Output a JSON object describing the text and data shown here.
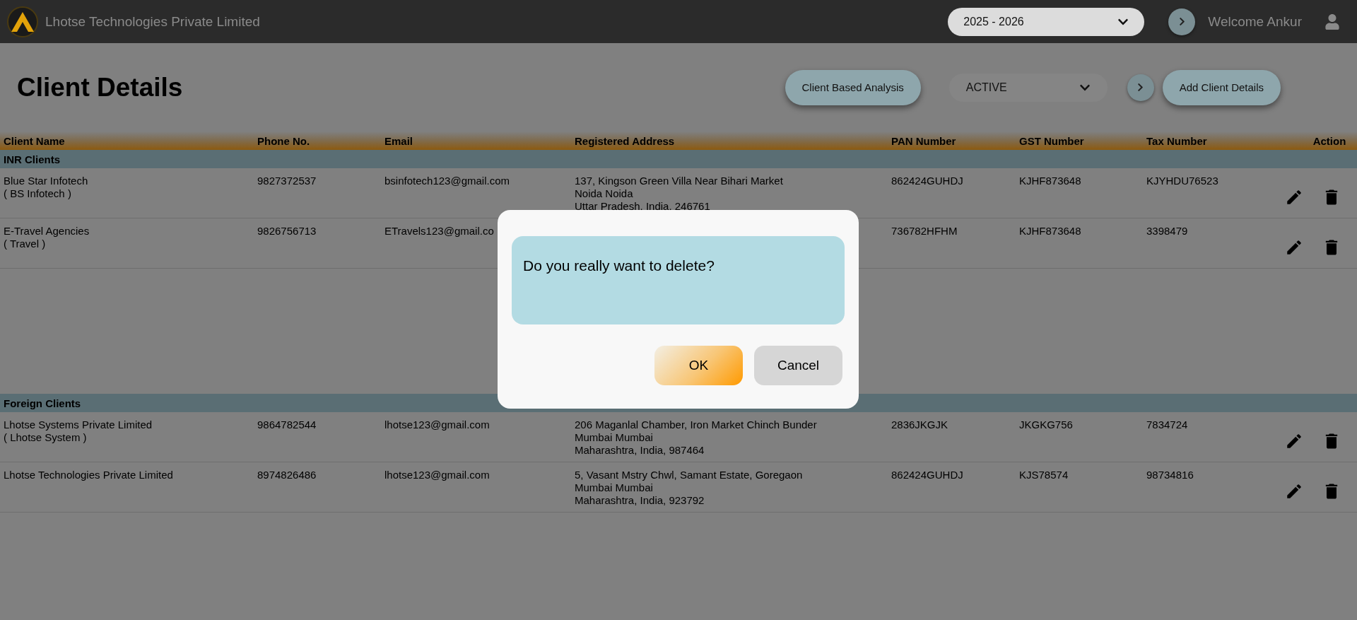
{
  "topbar": {
    "company": "Lhotse Technologies Private Limited",
    "year_select": {
      "value": "2025 - 2026"
    },
    "welcome": "Welcome Ankur"
  },
  "page": {
    "title": "Client Details",
    "analysis_button": "Client Based Analysis",
    "status_select": {
      "value": "ACTIVE"
    },
    "add_button": "Add Client Details"
  },
  "table": {
    "columns": [
      "Client Name",
      "Phone No.",
      "Email",
      "Registered Address",
      "PAN Number",
      "GST Number",
      "Tax Number",
      "Action"
    ],
    "groups": [
      {
        "label": "INR Clients",
        "rows": [
          {
            "name": "Blue Star Infotech",
            "alias": "( BS Infotech )",
            "phone": "9827372537",
            "email": "bsinfotech123@gmail.com",
            "address": [
              "137, Kingson Green Villa Near Bihari Market",
              "Noida Noida",
              "Uttar Pradesh, India, 246761"
            ],
            "pan": "862424GUHDJ",
            "gst": "KJHF873648",
            "tax": "KJYHDU76523"
          },
          {
            "name": "E-Travel Agencies",
            "alias": "( Travel )",
            "phone": "9826756713",
            "email": "ETravels123@gmail.co",
            "pan": "736782HFHM",
            "gst": "KJHF873648",
            "tax": "3398479"
          }
        ]
      },
      {
        "label": "Foreign Clients",
        "rows": [
          {
            "name": "Lhotse Systems Private Limited",
            "alias": "( Lhotse System )",
            "phone": "9864782544",
            "email": "lhotse123@gmail.com",
            "address": [
              "206 Maganlal Chamber, Iron Market Chinch Bunder",
              "Mumbai Mumbai",
              "Maharashtra, India, 987464"
            ],
            "pan": "2836JKGJK",
            "gst": "JKGKG756",
            "tax": "7834724"
          },
          {
            "name": "Lhotse Technologies Private Limited",
            "phone": "8974826486",
            "email": "lhotse123@gmail.com",
            "address": [
              "5, Vasant Mstry Chwl, Samant Estate, Goregaon",
              "Mumbai Mumbai",
              "Maharashtra, India, 923792"
            ],
            "pan": "862424GUHDJ",
            "gst": "KJS78574",
            "tax": "98734816"
          }
        ]
      }
    ]
  },
  "dialog": {
    "message": "Do you really want to delete?",
    "buttons": [
      {
        "label": "OK",
        "kind": "primary"
      },
      {
        "label": "Cancel",
        "kind": "secondary"
      }
    ]
  }
}
